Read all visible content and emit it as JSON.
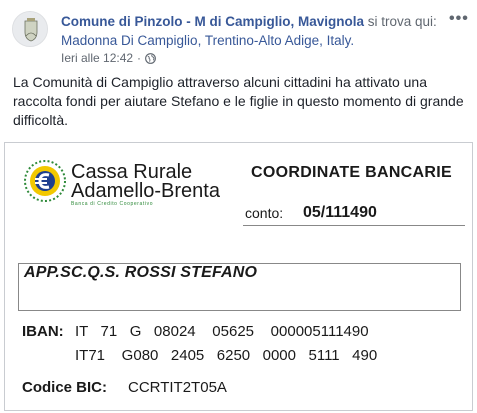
{
  "post": {
    "page_name": "Comune di Pinzolo - M di Campiglio, Mavignola",
    "location_prefix": "si trova qui:",
    "location": "Madonna Di Campiglio, Trentino-Alto Adige, Italy.",
    "timestamp": "Ieri alle 12:42",
    "separator": "·",
    "audience_icon": "globe-icon",
    "more_icon": "more-options-icon",
    "more_label": "•••",
    "text": "La Comunità di Campiglio attraverso alcuni cittadini ha attivato una raccolta fondi per aiutare Stefano e le figlie in questo momento di grande difficoltà."
  },
  "card": {
    "bank_name_line1": "Cassa Rurale",
    "bank_name_line2": "Adamello-Brenta",
    "bank_tagline": "Banca di Credito Cooperativo",
    "title": "COORDINATE BANCARIE",
    "conto_label": "conto:",
    "conto_value": "05/111490",
    "account_holder": "APP.SC.Q.S. ROSSI STEFANO",
    "iban_label": "IBAN:",
    "iban_line1": "IT   71   G   08024    05625    000005111490",
    "iban_line2": "IT71    G080   2405   6250   0000   5111   490",
    "bic_label": "Codice BIC:",
    "bic_value": "CCRTIT2T05A"
  },
  "colors": {
    "link": "#385898",
    "meta": "#606770",
    "text": "#1d2129",
    "logo_green": "#2f8a3a",
    "logo_yellow": "#f2c800",
    "logo_blue": "#1f3f8f"
  }
}
